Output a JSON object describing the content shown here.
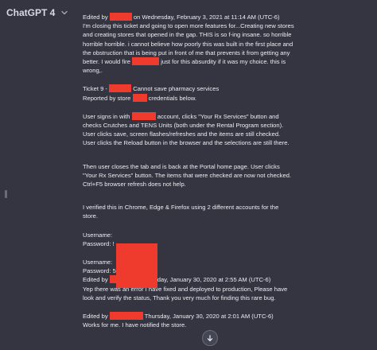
{
  "app": {
    "title": "ChatGPT 4"
  },
  "content": {
    "p1_edited": "Edited by",
    "p1_edited_rest": "on Wednesday, February 3, 2021 at 11:14 AM (UTC-6)",
    "p1_body": "I'm closing this ticket and going to open more features for...Creating new stores and creating stores that opened in the gap. THIS is so f-ing insane. so horrible horrible horrible. i cannot believe how poorly this was built in the first place and the obstruction that is being put in front of me that prevents it from getting any better. I would fire",
    "p1_tail": "just for this absurdity if it was my choice. this is wrong,.",
    "ticket_prefix": "Ticket 9 -",
    "ticket_suffix": "Cannot save pharmacy services",
    "reported_prefix": "Reported by store",
    "reported_suffix": "credentials below.",
    "p2_prefix": "User signs in with",
    "p2_rest": "account, clicks \"Your Rx Services\" button and checks Crutches and TENS Units (both under the Rental Program section). User clicks save, screen flashes/refreshes and the items are still checked. User clicks the Reload button in the browser and the selections are still there.",
    "p3": "Then user closes the tab and is back at the Portal home page. User clicks \"Your Rx Services\" button. The items that were checked are now not checked. Ctrl+F5 browser refresh does not help.",
    "p4": "I verified this in Chrome, Edge & Firefox using 2 different accounts for the store.",
    "username_1": "Username:",
    "password_1": "Password:",
    "password_1_tail": "!",
    "username_2": "Username:",
    "password_2": "Password:",
    "password_2_tail": "5",
    "edited2_prefix": "Edited by",
    "edited2_rest": "on Thursday, January 30, 2020 at 2:55 AM (UTC-6)",
    "reply": "Yep there was an error I have fixed and deployed to production, Please have look and verify the status, Thank you very much for finding this rare bug.",
    "edited3_prefix": "Edited by",
    "edited3_rest": "Thursday, January 30, 2020 at 2:01 AM (UTC-6)",
    "final": "Works for me. I have notified the store."
  },
  "colors": {
    "background": "#343541",
    "redaction": "#ef3b2d",
    "text": "#ececf1"
  },
  "icons": {
    "chevron": "chevron-down-icon",
    "scroll": "arrow-down-icon"
  }
}
